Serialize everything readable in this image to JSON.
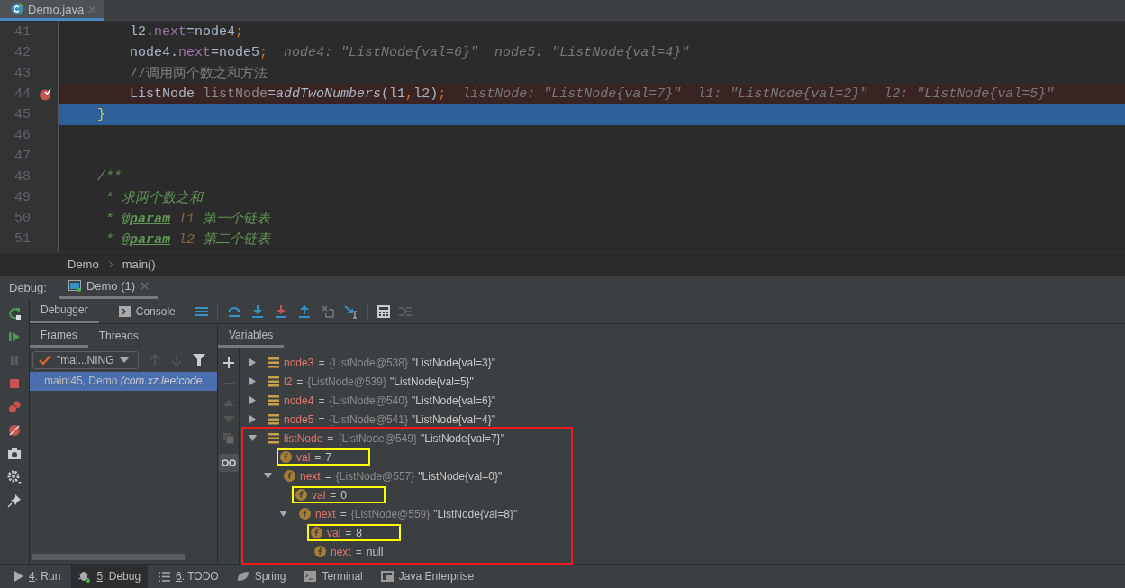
{
  "editor_tabs": [
    {
      "label": "Demo.java",
      "selected": true
    }
  ],
  "code_lines": [
    {
      "number": "41",
      "kind": "plain",
      "segments": [
        {
          "text": "        l2.",
          "kind": "plain"
        },
        {
          "text": "next",
          "kind": "field"
        },
        {
          "text": "=node4",
          "kind": "plain"
        },
        {
          "text": ";",
          "kind": "punct"
        }
      ]
    },
    {
      "number": "42",
      "kind": "plain",
      "segments": [
        {
          "text": "        node4.",
          "kind": "plain"
        },
        {
          "text": "next",
          "kind": "field"
        },
        {
          "text": "=node5",
          "kind": "plain"
        },
        {
          "text": ";",
          "kind": "punct"
        }
      ],
      "hint": "node4: \"ListNode{val=6}\"  node5: \"ListNode{val=4}\""
    },
    {
      "number": "43",
      "kind": "plain",
      "segments": [
        {
          "text": "        //调用两个数之和方法",
          "kind": "comment"
        }
      ]
    },
    {
      "number": "44",
      "kind": "breakpoint",
      "segments": [
        {
          "text": "        ListNode ",
          "kind": "plain"
        },
        {
          "text": "listNode",
          "kind": "local"
        },
        {
          "text": "=",
          "kind": "plain"
        },
        {
          "text": "addTwoNumbers",
          "kind": "call"
        },
        {
          "text": "(l1",
          "kind": "plain"
        },
        {
          "text": ",",
          "kind": "punct"
        },
        {
          "text": "l2)",
          "kind": "plain"
        },
        {
          "text": ";",
          "kind": "punct"
        }
      ],
      "hint": "listNode: \"ListNode{val=7}\"  l1: \"ListNode{val=2}\"  l2: \"ListNode{val=5}\""
    },
    {
      "number": "45",
      "kind": "current",
      "segments": [
        {
          "text": "    }",
          "kind": "brace"
        }
      ]
    },
    {
      "number": "46",
      "kind": "plain"
    },
    {
      "number": "47",
      "kind": "plain"
    },
    {
      "number": "48",
      "kind": "plain",
      "segments": [
        {
          "text": "    /**",
          "kind": "doc"
        }
      ]
    },
    {
      "number": "49",
      "kind": "plain",
      "segments": [
        {
          "text": "     * 求两个数之和",
          "kind": "doc"
        }
      ]
    },
    {
      "number": "50",
      "kind": "plain",
      "segments": [
        {
          "text": "     * ",
          "kind": "doc"
        },
        {
          "text": "@param",
          "kind": "doctag"
        },
        {
          "text": " l1",
          "kind": "docparam"
        },
        {
          "text": " 第一个链表",
          "kind": "doc"
        }
      ]
    },
    {
      "number": "51",
      "kind": "plain",
      "segments": [
        {
          "text": "     * ",
          "kind": "doc"
        },
        {
          "text": "@param",
          "kind": "doctag"
        },
        {
          "text": " l2",
          "kind": "docparam"
        },
        {
          "text": " 第二个链表",
          "kind": "doc"
        }
      ]
    }
  ],
  "breadcrumb": [
    "Demo",
    "main()"
  ],
  "debug": {
    "label": "Debug:",
    "sessions": [
      {
        "label": "Demo (1)",
        "selected": true
      }
    ],
    "tabs": [
      {
        "label": "Debugger",
        "selected": true
      },
      {
        "label": "Console",
        "selected": false
      }
    ],
    "frames_tabs": [
      {
        "label": "Frames",
        "selected": true
      },
      {
        "label": "Threads",
        "selected": false
      }
    ],
    "thread": "\"mai...NING",
    "frames": [
      {
        "method": "main:45, Demo ",
        "package": "(com.xz.leetcode.",
        "selected": true
      }
    ],
    "variables_title": "Variables",
    "variables": [
      {
        "kind": "object",
        "name": "node3",
        "sep": "=",
        "ref": "{ListNode@538}",
        "value": "\"ListNode{val=3}\"",
        "expanded": false,
        "outlined": false
      },
      {
        "kind": "object",
        "name": "l2",
        "sep": "=",
        "ref": "{ListNode@539}",
        "value": "\"ListNode{val=5}\"",
        "expanded": false,
        "outlined": false
      },
      {
        "kind": "object",
        "name": "node4",
        "sep": "=",
        "ref": "{ListNode@540}",
        "value": "\"ListNode{val=6}\"",
        "expanded": false,
        "outlined": false
      },
      {
        "kind": "object",
        "name": "node5",
        "sep": "=",
        "ref": "{ListNode@541}",
        "value": "\"ListNode{val=4}\"",
        "expanded": false,
        "outlined": false
      },
      {
        "kind": "object",
        "name": "listNode",
        "sep": "=",
        "ref": "{ListNode@549}",
        "value": "\"ListNode{val=7}\"",
        "expanded": true,
        "outlined": true,
        "children": [
          {
            "kind": "field",
            "name": "val",
            "sep": "=",
            "value": "7",
            "outlined": true
          },
          {
            "kind": "field",
            "name": "next",
            "sep": "=",
            "ref": "{ListNode@557}",
            "value": "\"ListNode{val=0}\"",
            "expanded": true,
            "outlined": false,
            "children": [
              {
                "kind": "field",
                "name": "val",
                "sep": "=",
                "value": "0",
                "outlined": true
              },
              {
                "kind": "field",
                "name": "next",
                "sep": "=",
                "ref": "{ListNode@559}",
                "value": "\"ListNode{val=8}\"",
                "expanded": true,
                "outlined": false,
                "children": [
                  {
                    "kind": "field",
                    "name": "val",
                    "sep": "=",
                    "value": "8",
                    "outlined": true
                  },
                  {
                    "kind": "field",
                    "name": "next",
                    "sep": "=",
                    "value": "null",
                    "outlined": false
                  }
                ]
              }
            ]
          }
        ]
      }
    ]
  },
  "tool_windows": [
    {
      "kind": "run",
      "mnemonic": "4",
      "label": ": Run",
      "selected": false
    },
    {
      "kind": "debug",
      "mnemonic": "5",
      "label": ": Debug",
      "selected": true
    },
    {
      "kind": "todo",
      "mnemonic": "6",
      "label": ": TODO",
      "selected": false
    },
    {
      "kind": "spring",
      "label": "Spring",
      "selected": false
    },
    {
      "kind": "terminal",
      "label": "Terminal",
      "selected": false
    },
    {
      "kind": "enterprise",
      "label": "Java Enterprise",
      "selected": false
    }
  ]
}
